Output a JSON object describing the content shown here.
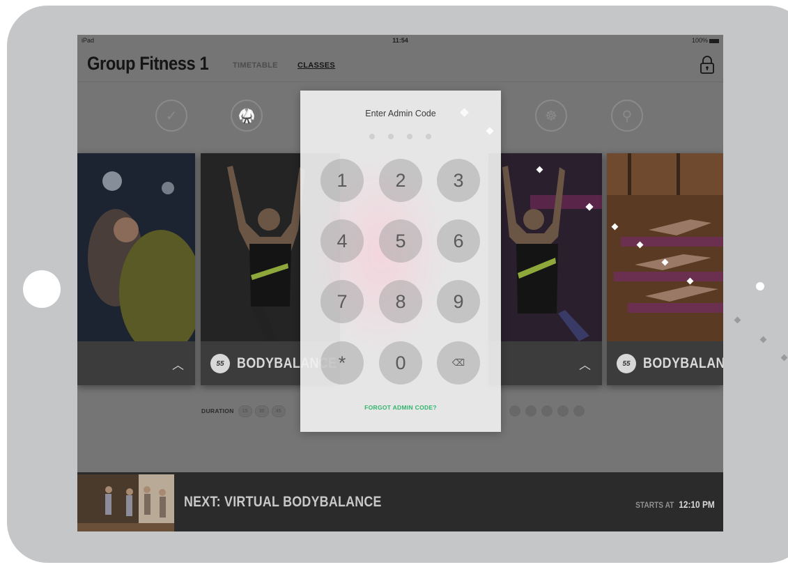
{
  "status_bar": {
    "device": "iPad",
    "time": "11:54",
    "battery": "100%"
  },
  "header": {
    "title": "Group Fitness 1",
    "tabs": [
      {
        "label": "TIMETABLE"
      },
      {
        "label": "CLASSES"
      }
    ],
    "lock_icon": "lock-icon"
  },
  "filter_icons": [
    "check-icon",
    "martial-arts-icon",
    "meditation-icon",
    "cycling-icon"
  ],
  "cards": [
    {
      "name": ""
    },
    {
      "name": "BODYBALANCE",
      "duration_badge": "55"
    },
    {
      "name": ""
    },
    {
      "name": "BODYBALANCE",
      "duration_badge": "55"
    }
  ],
  "duration": {
    "label": "DURATION",
    "options": [
      "15",
      "30",
      "45"
    ]
  },
  "modal": {
    "title": "Enter Admin Code",
    "keys": [
      "1",
      "2",
      "3",
      "4",
      "5",
      "6",
      "7",
      "8",
      "9",
      "*",
      "0",
      "⌫"
    ],
    "forgot_label": "FORGOT ADMIN CODE?"
  },
  "next_class": {
    "title": "NEXT: VIRTUAL BODYBALANCE",
    "starts_label": "STARTS AT",
    "starts_time": "12:10 PM"
  },
  "colors": {
    "device": "#c5c6c8",
    "accent_green": "#2fb56b",
    "next_bar": "#2b2b2b"
  }
}
